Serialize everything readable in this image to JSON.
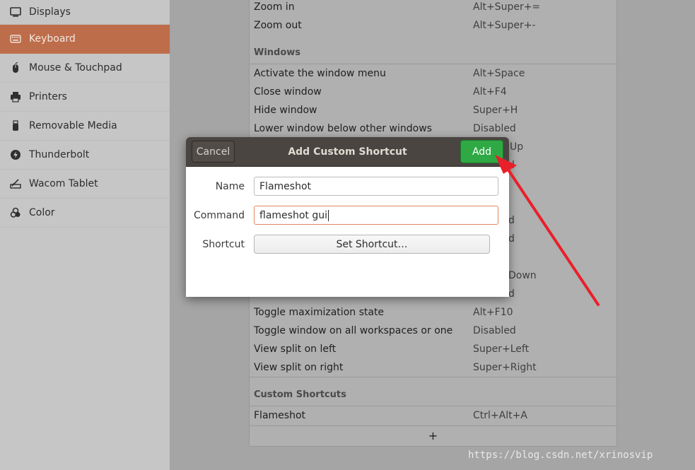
{
  "sidebar": {
    "items": [
      {
        "label": "Displays",
        "icon": "display-icon"
      },
      {
        "label": "Keyboard",
        "icon": "keyboard-icon",
        "active": true
      },
      {
        "label": "Mouse & Touchpad",
        "icon": "mouse-icon"
      },
      {
        "label": "Printers",
        "icon": "printer-icon"
      },
      {
        "label": "Removable Media",
        "icon": "usb-icon"
      },
      {
        "label": "Thunderbolt",
        "icon": "thunderbolt-icon"
      },
      {
        "label": "Wacom Tablet",
        "icon": "tablet-icon"
      },
      {
        "label": "Color",
        "icon": "color-icon"
      }
    ]
  },
  "shortcuts": {
    "top_rows": [
      {
        "name": "Zoom in",
        "accel": "Alt+Super+="
      },
      {
        "name": "Zoom out",
        "accel": "Alt+Super+-"
      }
    ],
    "windows_header": "Windows",
    "windows_rows_visible_top": [
      {
        "name": "Activate the window menu",
        "accel": "Alt+Space"
      },
      {
        "name": "Close window",
        "accel": "Alt+F4"
      },
      {
        "name": "Hide window",
        "accel": "Super+H"
      },
      {
        "name": "Lower window below other windows",
        "accel": "Disabled"
      }
    ],
    "partial_accels": [
      "Up",
      "d",
      "d",
      "d",
      "Down",
      "d"
    ],
    "windows_rows_visible_bottom": [
      {
        "name": "Toggle maximization state",
        "accel": "Alt+F10"
      },
      {
        "name": "Toggle window on all workspaces or one",
        "accel": "Disabled"
      },
      {
        "name": "View split on left",
        "accel": "Super+Left"
      },
      {
        "name": "View split on right",
        "accel": "Super+Right"
      }
    ],
    "custom_header": "Custom Shortcuts",
    "custom_rows": [
      {
        "name": "Flameshot",
        "accel": "Ctrl+Alt+A"
      }
    ],
    "add_symbol": "+"
  },
  "dialog": {
    "title": "Add Custom Shortcut",
    "cancel_label": "Cancel",
    "add_label": "Add",
    "name_label": "Name",
    "name_value": "Flameshot",
    "command_label": "Command",
    "command_value": "flameshot gui",
    "shortcut_label": "Shortcut",
    "set_shortcut_label": "Set Shortcut…"
  },
  "colors": {
    "active_sidebar": "#bd6d4a",
    "add_button": "#2fa944",
    "dialog_header": "#4a4541",
    "annotation_arrow": "#e8202a"
  },
  "watermark": "https://blog.csdn.net/xrinosvip"
}
